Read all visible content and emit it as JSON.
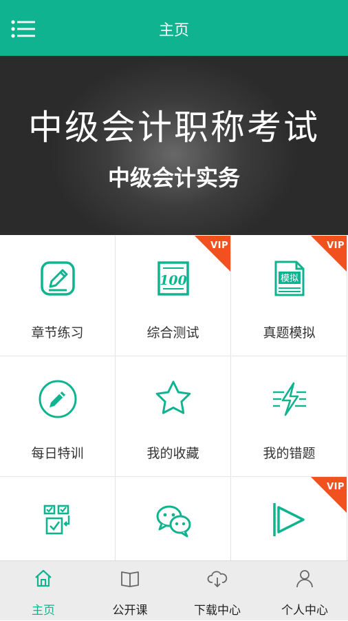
{
  "colors": {
    "primary": "#0fb38f",
    "vip_badge": "#f1501f",
    "banner_bg": "#2f2f2f",
    "tabbar_bg": "#ececec"
  },
  "header": {
    "title": "主页",
    "menu_icon": "list-menu-icon"
  },
  "banner": {
    "title": "中级会计职称考试",
    "subtitle": "中级会计实务"
  },
  "grid": {
    "items": [
      {
        "label": "章节练习",
        "icon": "pencil-square-icon",
        "vip": false
      },
      {
        "label": "综合测试",
        "icon": "score-100-icon",
        "vip": true,
        "vip_text": "VIP"
      },
      {
        "label": "真题模拟",
        "icon": "mock-exam-document-icon",
        "vip": true,
        "vip_text": "VIP",
        "icon_text": "模拟"
      },
      {
        "label": "每日特训",
        "icon": "pencil-circle-icon",
        "vip": false
      },
      {
        "label": "我的收藏",
        "icon": "star-icon",
        "vip": false
      },
      {
        "label": "我的错题",
        "icon": "lightning-lines-icon",
        "vip": false
      },
      {
        "label": "",
        "icon": "checklist-icon",
        "vip": false
      },
      {
        "label": "",
        "icon": "wechat-chat-icon",
        "vip": false
      },
      {
        "label": "",
        "icon": "play-video-icon",
        "vip": true,
        "vip_text": "VIP"
      }
    ]
  },
  "tabbar": {
    "tabs": [
      {
        "label": "主页",
        "icon": "home-icon",
        "active": true
      },
      {
        "label": "公开课",
        "icon": "open-book-icon",
        "active": false
      },
      {
        "label": "下载中心",
        "icon": "cloud-download-icon",
        "active": false
      },
      {
        "label": "个人中心",
        "icon": "user-icon",
        "active": false
      }
    ]
  }
}
